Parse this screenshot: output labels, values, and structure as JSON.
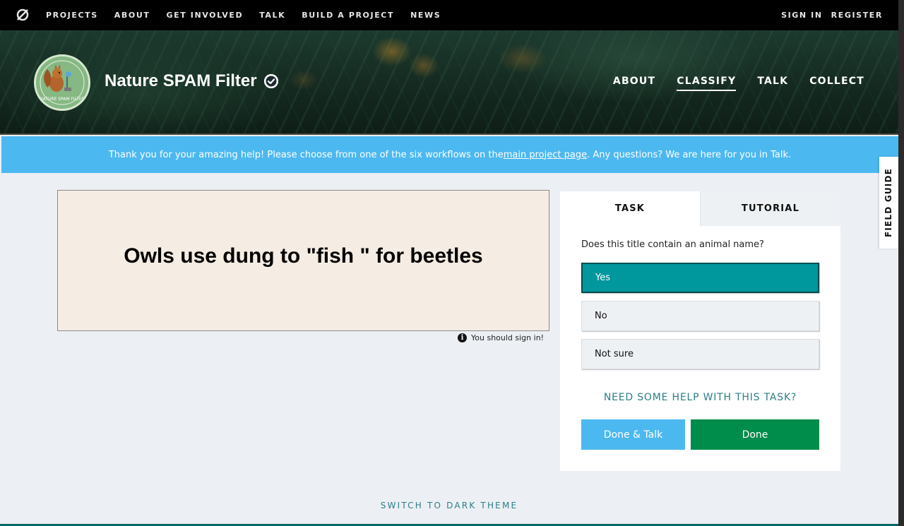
{
  "topnav": {
    "links": [
      "PROJECTS",
      "ABOUT",
      "GET INVOLVED",
      "TALK",
      "BUILD A PROJECT",
      "NEWS"
    ],
    "sign_in": "SIGN IN",
    "register": "REGISTER"
  },
  "project": {
    "title": "Nature SPAM Filter",
    "nav": [
      "ABOUT",
      "CLASSIFY",
      "TALK",
      "COLLECT"
    ],
    "active_nav": "CLASSIFY",
    "logo_text": "NATURE SPAM FILTER"
  },
  "banner": {
    "before": "Thank you for your amazing help! Please choose from one of the six workflows on the ",
    "link": "main project page",
    "after": ". Any questions? We are here for you in Talk."
  },
  "field_guide": "FIELD GUIDE",
  "subject": {
    "text": "Owls use dung to  \"fish \" for beetles",
    "signin_note": "You should sign in!"
  },
  "task_panel": {
    "tabs": [
      "TASK",
      "TUTORIAL"
    ],
    "question": "Does this title contain an animal name?",
    "answers": [
      "Yes",
      "No",
      "Not sure"
    ],
    "selected_answer": "Yes",
    "help_link": "NEED SOME HELP WITH THIS TASK?",
    "done_talk": "Done & Talk",
    "done": "Done"
  },
  "footer": {
    "dark_theme": "SWITCH TO DARK THEME"
  },
  "colors": {
    "banner": "#4cb8f0",
    "selected_answer": "#00979d",
    "done": "#008c4a",
    "link": "#2b7f85"
  }
}
